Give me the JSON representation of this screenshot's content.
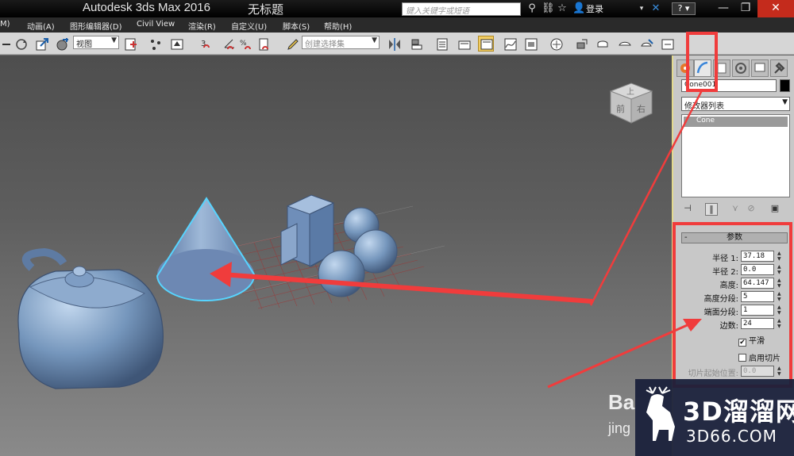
{
  "title_bar": {
    "app_title": "Autodesk 3ds Max 2016",
    "doc_title": "无标题",
    "search_placeholder": "键入关键字或短语",
    "sign_in": "登录",
    "help": "?",
    "window_buttons": {
      "minimize": "—",
      "restore": "❐",
      "close": "✕"
    }
  },
  "menu": {
    "items": [
      "M)",
      "动画(A)",
      "图形编辑器(D)",
      "Civil View",
      "渲染(R)",
      "自定义(U)",
      "脚本(S)",
      "帮助(H)"
    ]
  },
  "toolbar": {
    "view_dropdown": "视图",
    "selection_set_dropdown": "创建选择集"
  },
  "viewport": {
    "viewcube": {
      "top_face": "上",
      "front_face": "前",
      "right_face": "右"
    },
    "objects": [
      "teapot",
      "cone",
      "box",
      "sphere",
      "sphere",
      "sphere"
    ],
    "selected_object": "cone",
    "selection_color": "#57d4ff"
  },
  "command_panel": {
    "tabs": [
      "create-icon",
      "modify-icon",
      "hierarchy-icon",
      "motion-icon",
      "display-icon",
      "utilities-icon"
    ],
    "object_name": "Cone001",
    "modifier_list": "修改器列表",
    "stack_item": "Cone",
    "parameters": {
      "header": "参数",
      "collapse": "-",
      "rows": [
        {
          "label": "半径 1:",
          "value": "37.18"
        },
        {
          "label": "半径 2:",
          "value": "0.0"
        },
        {
          "label": "高度:",
          "value": "64.147"
        },
        {
          "label": "高度分段:",
          "value": "5"
        },
        {
          "label": "端面分段:",
          "value": "1"
        },
        {
          "label": "边数:",
          "value": "24"
        }
      ],
      "smooth_label": "平滑",
      "smooth_checked": true,
      "slice_label": "启用切片",
      "slice_checked": false,
      "slice_from_label": "切片起始位置:",
      "slice_from_value": "0.0"
    }
  },
  "annotation_color": "#f03c3c",
  "watermark": {
    "baidu_text": "Ba",
    "baidu_sub": "jing",
    "brand_cn": "3D溜溜网",
    "brand_url": "3D66.COM"
  }
}
